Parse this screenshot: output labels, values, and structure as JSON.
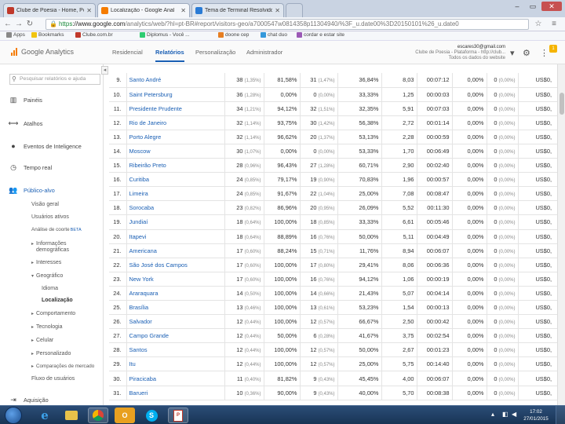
{
  "browser": {
    "tabs": [
      {
        "label": "Clube de Poesia - Home, Poe",
        "favicon": "#c0392b"
      },
      {
        "label": "Localização - Google Anal",
        "favicon": "#f57c00"
      },
      {
        "label": "Tema de Terminal Resolvido",
        "favicon": "#2a7bd5"
      }
    ],
    "url_https": "https",
    "url_domain": "://www.google.com",
    "url_rest": "/analytics/web/?hl=pt-BR#report/visitors-geo/a7000547w0814358p11304940/%3F_u.date00%3D20150101%26_u.date0",
    "bookmarks": [
      "Apps",
      "Bookmarks",
      "Clube.com.br",
      "Diplomus - Você ...",
      "doone cep",
      "chat duo",
      "cordar e estar site"
    ]
  },
  "ga": {
    "brand": "Google Analytics",
    "nav": [
      "Residencial",
      "Relatórios",
      "Personalização",
      "Administrador"
    ],
    "account_line1": "escares30@gmail.com",
    "account_line2": "Clube de Poesia - Plataforma - http://club...",
    "account_line3": "Todos os dados do website"
  },
  "sidebar": {
    "search_placeholder": "Pesquisar relatórios e ajuda",
    "sections": [
      {
        "icon": "dashboard-icon",
        "label": "Painéis"
      },
      {
        "icon": "shortcut-icon",
        "label": "Atalhos"
      },
      {
        "icon": "lightbulb-icon",
        "label": "Eventos de Inteligence"
      },
      {
        "icon": "clock-icon",
        "label": "Tempo real"
      },
      {
        "icon": "people-icon",
        "label": "Público-alvo"
      }
    ],
    "sub": {
      "overview": "Visão geral",
      "active_users": "Usuários ativos",
      "cohort": "Análise de coorte",
      "beta": "BETA",
      "demographics": "Informações demográficas",
      "interests": "Interesses",
      "geo": "Geográfico",
      "language": "Idioma",
      "location": "Localização",
      "behavior": "Comportamento",
      "technology": "Tecnologia",
      "mobile": "Celular",
      "custom": "Personalizado",
      "benchmarking": "Comparações de mercado",
      "users_flow": "Fluxo de usuários"
    },
    "acquisition": {
      "icon": "acquisition-icon",
      "label": "Aquisição"
    }
  },
  "table": {
    "rows": [
      {
        "rank": "9.",
        "city": "Santo André",
        "sessions": "38",
        "sessions_pct": "(1,35%)",
        "new_pct": "81,58%",
        "new_users": "31",
        "new_users_pct": "(1,47%)",
        "bounce": "36,84%",
        "pages": "8,03",
        "duration": "00:07:12",
        "conv": "0,00%",
        "goals": "0",
        "goals_pct": "(0,00%)",
        "value": "US$0,"
      },
      {
        "rank": "10.",
        "city": "Saint Petersburg",
        "sessions": "36",
        "sessions_pct": "(1,28%)",
        "new_pct": "0,00%",
        "new_users": "0",
        "new_users_pct": "(0,00%)",
        "bounce": "33,33%",
        "pages": "1,25",
        "duration": "00:00:03",
        "conv": "0,00%",
        "goals": "0",
        "goals_pct": "(0,00%)",
        "value": "US$0,"
      },
      {
        "rank": "11.",
        "city": "Presidente Prudente",
        "sessions": "34",
        "sessions_pct": "(1,21%)",
        "new_pct": "94,12%",
        "new_users": "32",
        "new_users_pct": "(1,51%)",
        "bounce": "32,35%",
        "pages": "5,91",
        "duration": "00:07:03",
        "conv": "0,00%",
        "goals": "0",
        "goals_pct": "(0,00%)",
        "value": "US$0,"
      },
      {
        "rank": "12.",
        "city": "Rio de Janeiro",
        "sessions": "32",
        "sessions_pct": "(1,14%)",
        "new_pct": "93,75%",
        "new_users": "30",
        "new_users_pct": "(1,42%)",
        "bounce": "56,38%",
        "pages": "2,72",
        "duration": "00:01:14",
        "conv": "0,00%",
        "goals": "0",
        "goals_pct": "(0,00%)",
        "value": "US$0,"
      },
      {
        "rank": "13.",
        "city": "Porto Alegre",
        "sessions": "32",
        "sessions_pct": "(1,14%)",
        "new_pct": "96,62%",
        "new_users": "20",
        "new_users_pct": "(1,37%)",
        "bounce": "53,13%",
        "pages": "2,28",
        "duration": "00:00:59",
        "conv": "0,00%",
        "goals": "0",
        "goals_pct": "(0,00%)",
        "value": "US$0,"
      },
      {
        "rank": "14.",
        "city": "Moscow",
        "sessions": "30",
        "sessions_pct": "(1,07%)",
        "new_pct": "0,00%",
        "new_users": "0",
        "new_users_pct": "(0,00%)",
        "bounce": "53,33%",
        "pages": "1,70",
        "duration": "00:06:49",
        "conv": "0,00%",
        "goals": "0",
        "goals_pct": "(0,00%)",
        "value": "US$0,"
      },
      {
        "rank": "15.",
        "city": "Ribeirão Preto",
        "sessions": "28",
        "sessions_pct": "(0,96%)",
        "new_pct": "96,43%",
        "new_users": "27",
        "new_users_pct": "(1,28%)",
        "bounce": "60,71%",
        "pages": "2,90",
        "duration": "00:02:40",
        "conv": "0,00%",
        "goals": "0",
        "goals_pct": "(0,00%)",
        "value": "US$0,"
      },
      {
        "rank": "16.",
        "city": "Curitiba",
        "sessions": "24",
        "sessions_pct": "(0,85%)",
        "new_pct": "79,17%",
        "new_users": "19",
        "new_users_pct": "(0,90%)",
        "bounce": "70,83%",
        "pages": "1,96",
        "duration": "00:00:57",
        "conv": "0,00%",
        "goals": "0",
        "goals_pct": "(0,00%)",
        "value": "US$0,"
      },
      {
        "rank": "17.",
        "city": "Limeira",
        "sessions": "24",
        "sessions_pct": "(0,85%)",
        "new_pct": "91,67%",
        "new_users": "22",
        "new_users_pct": "(1,04%)",
        "bounce": "25,00%",
        "pages": "7,08",
        "duration": "00:08:47",
        "conv": "0,00%",
        "goals": "0",
        "goals_pct": "(0,00%)",
        "value": "US$0,"
      },
      {
        "rank": "18.",
        "city": "Sorocaba",
        "sessions": "23",
        "sessions_pct": "(0,82%)",
        "new_pct": "86,96%",
        "new_users": "20",
        "new_users_pct": "(0,95%)",
        "bounce": "26,09%",
        "pages": "5,52",
        "duration": "00:11:30",
        "conv": "0,00%",
        "goals": "0",
        "goals_pct": "(0,00%)",
        "value": "US$0,"
      },
      {
        "rank": "19.",
        "city": "Jundiaí",
        "sessions": "18",
        "sessions_pct": "(0,64%)",
        "new_pct": "100,00%",
        "new_users": "18",
        "new_users_pct": "(0,85%)",
        "bounce": "33,33%",
        "pages": "6,61",
        "duration": "00:05:46",
        "conv": "0,00%",
        "goals": "0",
        "goals_pct": "(0,00%)",
        "value": "US$0,"
      },
      {
        "rank": "20.",
        "city": "Itapevi",
        "sessions": "18",
        "sessions_pct": "(0,64%)",
        "new_pct": "88,89%",
        "new_users": "16",
        "new_users_pct": "(0,76%)",
        "bounce": "50,00%",
        "pages": "5,11",
        "duration": "00:04:49",
        "conv": "0,00%",
        "goals": "0",
        "goals_pct": "(0,00%)",
        "value": "US$0,"
      },
      {
        "rank": "21.",
        "city": "Americana",
        "sessions": "17",
        "sessions_pct": "(0,60%)",
        "new_pct": "88,24%",
        "new_users": "15",
        "new_users_pct": "(0,71%)",
        "bounce": "11,76%",
        "pages": "8,94",
        "duration": "00:06:07",
        "conv": "0,00%",
        "goals": "0",
        "goals_pct": "(0,00%)",
        "value": "US$0,"
      },
      {
        "rank": "22.",
        "city": "São José dos Campos",
        "sessions": "17",
        "sessions_pct": "(0,60%)",
        "new_pct": "100,00%",
        "new_users": "17",
        "new_users_pct": "(0,80%)",
        "bounce": "29,41%",
        "pages": "8,06",
        "duration": "00:06:36",
        "conv": "0,00%",
        "goals": "0",
        "goals_pct": "(0,00%)",
        "value": "US$0,"
      },
      {
        "rank": "23.",
        "city": "New York",
        "sessions": "17",
        "sessions_pct": "(0,60%)",
        "new_pct": "100,00%",
        "new_users": "16",
        "new_users_pct": "(0,76%)",
        "bounce": "94,12%",
        "pages": "1,06",
        "duration": "00:00:19",
        "conv": "0,00%",
        "goals": "0",
        "goals_pct": "(0,00%)",
        "value": "US$0,"
      },
      {
        "rank": "24.",
        "city": "Araraquara",
        "sessions": "14",
        "sessions_pct": "(0,50%)",
        "new_pct": "100,00%",
        "new_users": "14",
        "new_users_pct": "(0,66%)",
        "bounce": "21,43%",
        "pages": "5,07",
        "duration": "00:04:14",
        "conv": "0,00%",
        "goals": "0",
        "goals_pct": "(0,00%)",
        "value": "US$0,"
      },
      {
        "rank": "25.",
        "city": "Brasília",
        "sessions": "13",
        "sessions_pct": "(0,46%)",
        "new_pct": "100,00%",
        "new_users": "13",
        "new_users_pct": "(0,61%)",
        "bounce": "53,23%",
        "pages": "1,54",
        "duration": "00:00:13",
        "conv": "0,00%",
        "goals": "0",
        "goals_pct": "(0,00%)",
        "value": "US$0,"
      },
      {
        "rank": "26.",
        "city": "Salvador",
        "sessions": "12",
        "sessions_pct": "(0,44%)",
        "new_pct": "100,00%",
        "new_users": "12",
        "new_users_pct": "(0,57%)",
        "bounce": "66,67%",
        "pages": "2,50",
        "duration": "00:00:42",
        "conv": "0,00%",
        "goals": "0",
        "goals_pct": "(0,00%)",
        "value": "US$0,"
      },
      {
        "rank": "27.",
        "city": "Campo Grande",
        "sessions": "12",
        "sessions_pct": "(0,44%)",
        "new_pct": "50,00%",
        "new_users": "6",
        "new_users_pct": "(0,28%)",
        "bounce": "41,67%",
        "pages": "3,75",
        "duration": "00:02:54",
        "conv": "0,00%",
        "goals": "0",
        "goals_pct": "(0,00%)",
        "value": "US$0,"
      },
      {
        "rank": "28.",
        "city": "Santos",
        "sessions": "12",
        "sessions_pct": "(0,44%)",
        "new_pct": "100,00%",
        "new_users": "12",
        "new_users_pct": "(0,57%)",
        "bounce": "50,00%",
        "pages": "2,67",
        "duration": "00:01:23",
        "conv": "0,00%",
        "goals": "0",
        "goals_pct": "(0,00%)",
        "value": "US$0,"
      },
      {
        "rank": "29.",
        "city": "Itu",
        "sessions": "12",
        "sessions_pct": "(0,44%)",
        "new_pct": "100,00%",
        "new_users": "12",
        "new_users_pct": "(0,57%)",
        "bounce": "25,00%",
        "pages": "5,75",
        "duration": "00:14:40",
        "conv": "0,00%",
        "goals": "0",
        "goals_pct": "(0,00%)",
        "value": "US$0,"
      },
      {
        "rank": "30.",
        "city": "Piracicaba",
        "sessions": "11",
        "sessions_pct": "(0,40%)",
        "new_pct": "81,82%",
        "new_users": "9",
        "new_users_pct": "(0,43%)",
        "bounce": "45,45%",
        "pages": "4,00",
        "duration": "00:06:07",
        "conv": "0,00%",
        "goals": "0",
        "goals_pct": "(0,00%)",
        "value": "US$0,"
      },
      {
        "rank": "31.",
        "city": "Barueri",
        "sessions": "10",
        "sessions_pct": "(0,36%)",
        "new_pct": "90,00%",
        "new_users": "9",
        "new_users_pct": "(0,43%)",
        "bounce": "40,00%",
        "pages": "5,70",
        "duration": "00:08:38",
        "conv": "0,00%",
        "goals": "0",
        "goals_pct": "(0,00%)",
        "value": "US$0,"
      }
    ]
  },
  "taskbar": {
    "apps": [
      "ie-icon",
      "explorer-icon",
      "chrome-icon",
      "outlook-icon",
      "skype-icon",
      "pdf-icon"
    ],
    "time": "17:02",
    "date": "27/01/2015"
  }
}
